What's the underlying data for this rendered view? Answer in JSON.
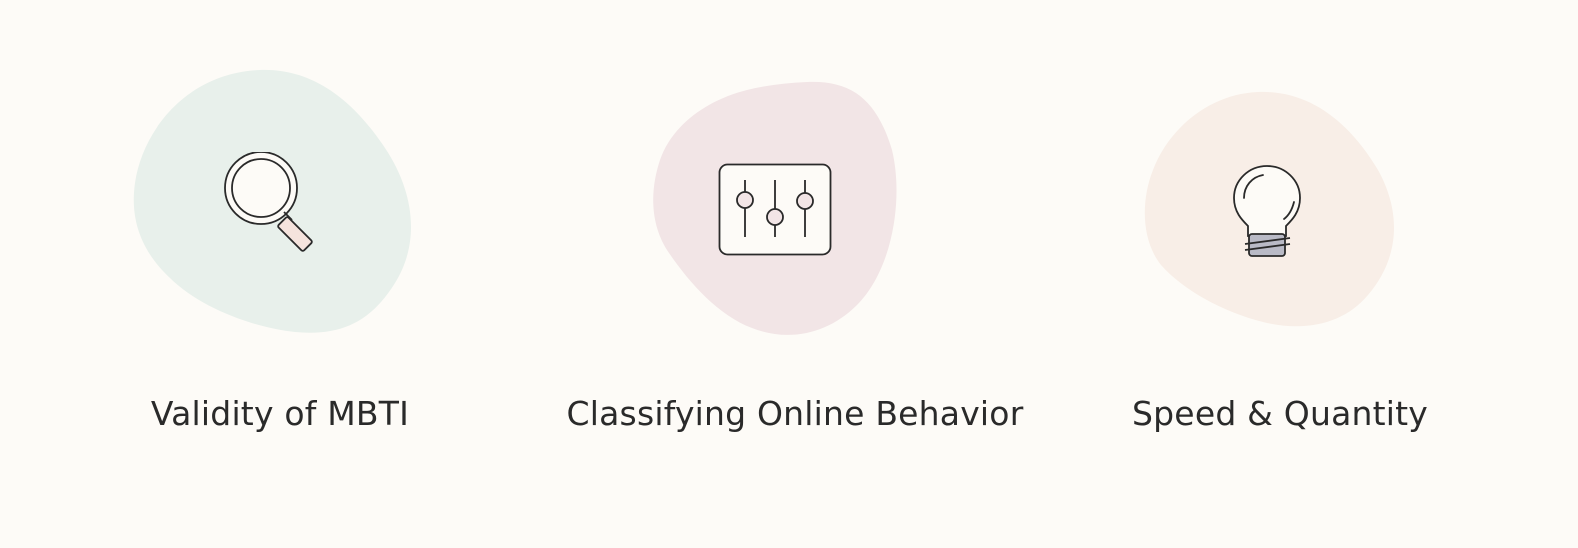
{
  "page": {
    "background": "#fdfbf7",
    "text_color": "#2a2a2a",
    "line_color": "#2a2a2a"
  },
  "features": [
    {
      "title": "Validity of MBTI",
      "icon": "magnifying-glass-icon",
      "blob_color": "#e8f0eb"
    },
    {
      "title": "Classifying Online Behavior",
      "icon": "sliders-panel-icon",
      "blob_color": "#f2e5e6"
    },
    {
      "title": "Speed & Quantity",
      "icon": "lightbulb-icon",
      "blob_color": "#f8eee7"
    }
  ]
}
